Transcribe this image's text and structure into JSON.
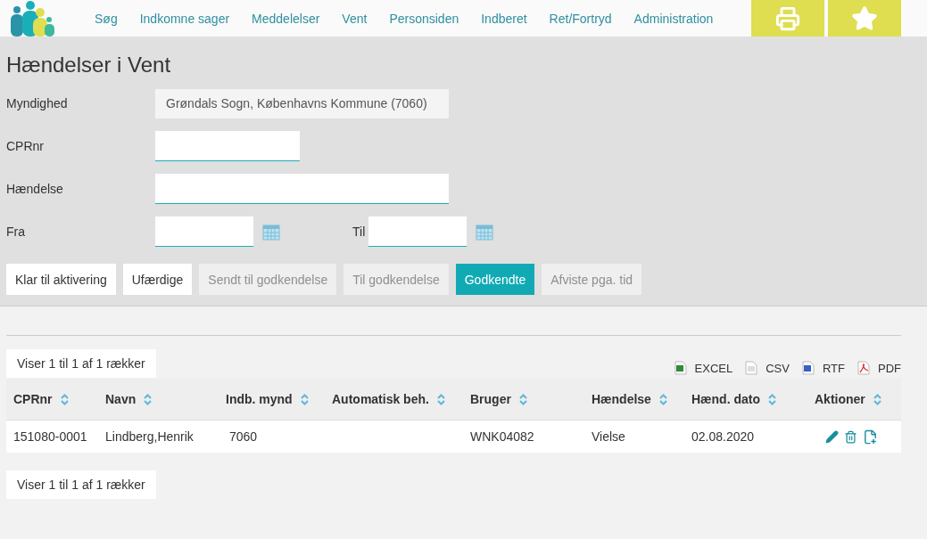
{
  "nav": {
    "items": [
      "Søg",
      "Indkomne sager",
      "Meddelelser",
      "Vent",
      "Personsiden",
      "Indberet",
      "Ret/Fortryd",
      "Administration"
    ]
  },
  "page_title": "Hændelser i Vent",
  "form": {
    "authority": {
      "label": "Myndighed",
      "value": "Grøndals Sogn, Københavns Kommune (7060)"
    },
    "cpr": {
      "label": "CPRnr"
    },
    "event": {
      "label": "Hændelse"
    },
    "from": {
      "label": "Fra"
    },
    "to": {
      "label": "Til"
    }
  },
  "filters": [
    {
      "label": "Klar til aktivering",
      "selected": false,
      "disabled": false
    },
    {
      "label": "Ufærdige",
      "selected": false,
      "disabled": false
    },
    {
      "label": "Sendt til godkendelse",
      "selected": false,
      "disabled": true
    },
    {
      "label": "Til godkendelse",
      "selected": false,
      "disabled": true
    },
    {
      "label": "Godkendte",
      "selected": true,
      "disabled": false
    },
    {
      "label": "Afviste pga. tid",
      "selected": false,
      "disabled": true
    }
  ],
  "info_top": "Viser 1 til 1 af 1 rækker",
  "exports": [
    {
      "kind": "excel",
      "label": "EXCEL"
    },
    {
      "kind": "csv",
      "label": "CSV"
    },
    {
      "kind": "rtf",
      "label": "RTF"
    },
    {
      "kind": "pdf",
      "label": "PDF"
    }
  ],
  "table": {
    "columns": [
      "CPRnr",
      "Navn",
      "Indb. mynd",
      "Automatisk beh.",
      "Bruger",
      "Hændelse",
      "Hænd. dato",
      "Aktioner"
    ],
    "rows": [
      {
        "cells": [
          "151080-0001",
          "Lindberg,Henrik",
          "7060",
          "",
          "WNK04082",
          "Vielse",
          "02.08.2020"
        ]
      }
    ]
  },
  "info_bottom": "Viser 1 til 1 af 1 rækker"
}
